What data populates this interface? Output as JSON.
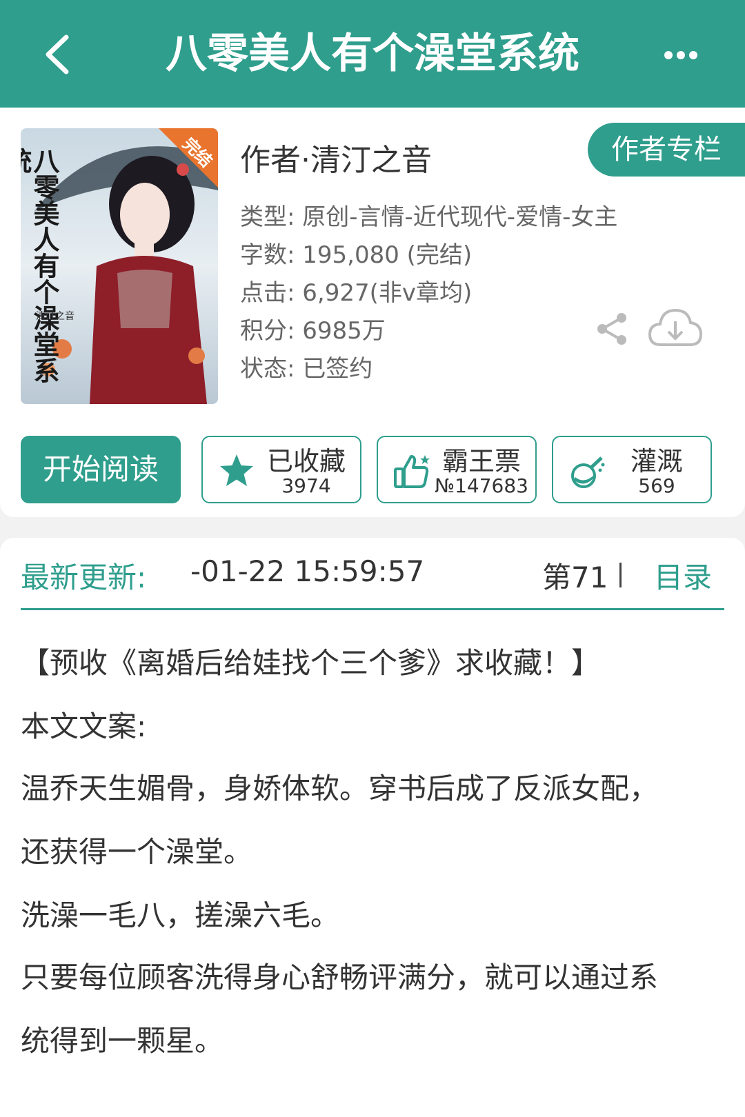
{
  "header": {
    "title": "八零美人有个澡堂系统",
    "back_icon": "back-arrow-icon",
    "more_icon": "more-icon"
  },
  "book": {
    "cover_badge": "完结",
    "cover_title": "八零美人有个澡堂系统",
    "cover_author": "清汀之音",
    "author_line": "作者·清汀之音",
    "author_column_label": "作者专栏",
    "meta": {
      "type": "类型: 原创-言情-近代现代-爱情-女主",
      "words": "字数: 195,080 (完结)",
      "clicks": "点击: 6,927(非v章均)",
      "score": "积分: 6985万",
      "status": "状态: 已签约"
    }
  },
  "actions": {
    "start_reading": "开始阅读",
    "favorite": {
      "label": "已收藏",
      "count": "3974",
      "icon": "star-icon"
    },
    "vote": {
      "label": "霸王票",
      "count": "№147683",
      "icon": "thumbs-up-icon"
    },
    "nutrient": {
      "label": "灌溉",
      "count": "569",
      "icon": "flask-icon"
    }
  },
  "update": {
    "label": "最新更新:",
    "time": "-01-22 15:59:57",
    "chapter": "第71",
    "toc": "目录"
  },
  "synopsis": {
    "lines": [
      "【预收《离婚后给娃找个三个爹》求收藏！】",
      "本文文案:",
      "温乔天生媚骨，身娇体软。穿书后成了反派女配，",
      "还获得一个澡堂。",
      "洗澡一毛八，搓澡六毛。",
      "只要每位顾客洗得身心舒畅评满分，就可以通过系",
      "统得到一颗星。"
    ]
  },
  "colors": {
    "primary": "#2f9e8d",
    "text": "#333333",
    "muted": "#666666"
  }
}
